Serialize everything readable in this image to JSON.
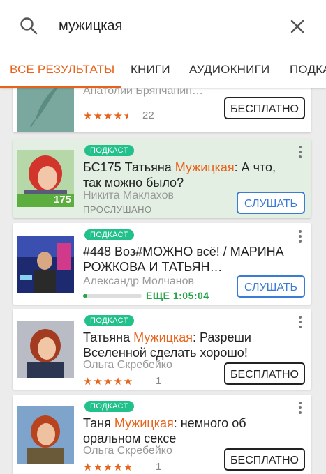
{
  "search": {
    "query": "мужицкая"
  },
  "tabs": [
    {
      "label": "ВСЕ РЕЗУЛЬТАТЫ"
    },
    {
      "label": "КНИГИ"
    },
    {
      "label": "АУДИОКНИГИ"
    },
    {
      "label": "ПОДКА"
    }
  ],
  "items": [
    {
      "author": "Анатолий Брянчанин…",
      "rating_count": "22",
      "rating": 4.5,
      "button": "БЕСПЛАТНО"
    },
    {
      "badge": "ПОДКАСТ",
      "title_pre": "БС175 Татьяна ",
      "title_hl": "Мужицкая",
      "title_post": ": А что, так можно было?",
      "author": "Никита Маклахов",
      "status": "ПРОСЛУШАНО",
      "button": "СЛУШАТЬ",
      "cover_number": "175"
    },
    {
      "badge": "ПОДКАСТ",
      "title_pre": "#448 Воз#МОЖНО всё! / МАРИНА РОЖКОВА И ТАТЬЯН…",
      "author": "Александр Молчанов",
      "remaining": "ЕЩЕ 1:05:04",
      "progress": 0.07,
      "button": "СЛУШАТЬ"
    },
    {
      "badge": "ПОДКАСТ",
      "title_pre": "Татьяна ",
      "title_hl": "Мужицкая",
      "title_post": ": Разреши Вселенной сделать хорошо!",
      "author": "Ольга Скребейко",
      "rating": 5,
      "rating_count": "1",
      "button": "БЕСПЛАТНО"
    },
    {
      "badge": "ПОДКАСТ",
      "title_pre": "Таня ",
      "title_hl": "Мужицкая",
      "title_post": ": немного об оральном сексе",
      "author": "Ольга Скребейко",
      "rating": 5,
      "rating_count": "1",
      "button": "БЕСПЛАТНО"
    }
  ],
  "colors": {
    "accent": "#e8621a",
    "podcast_badge": "#22c08a",
    "listen": "#3a7bd5",
    "progress": "#26a34a"
  }
}
